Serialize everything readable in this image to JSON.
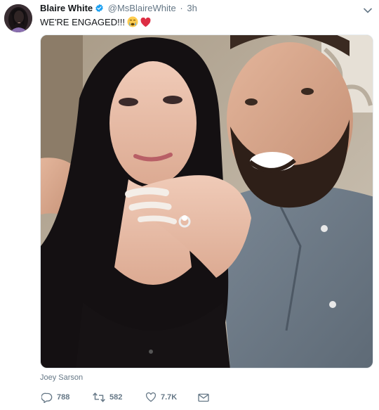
{
  "tweet": {
    "display_name": "Blaire White",
    "handle": "@MsBlaireWhite",
    "separator": "·",
    "time": "3h",
    "text": "WE'RE ENGAGED!!!",
    "emojis": [
      "crying-face-icon",
      "red-heart-icon"
    ],
    "tagged": "Joey Sarson"
  },
  "actions": {
    "reply_count": "788",
    "retweet_count": "582",
    "like_count": "7.7K"
  },
  "icons": {
    "verified": "verified-badge-icon",
    "menu": "chevron-down-icon",
    "reply": "reply-icon",
    "retweet": "retweet-icon",
    "like": "heart-icon",
    "dm": "envelope-icon"
  },
  "colors": {
    "verified": "#1da1f2",
    "muted": "#657786",
    "text": "#14171a",
    "heart": "#e0245e"
  }
}
